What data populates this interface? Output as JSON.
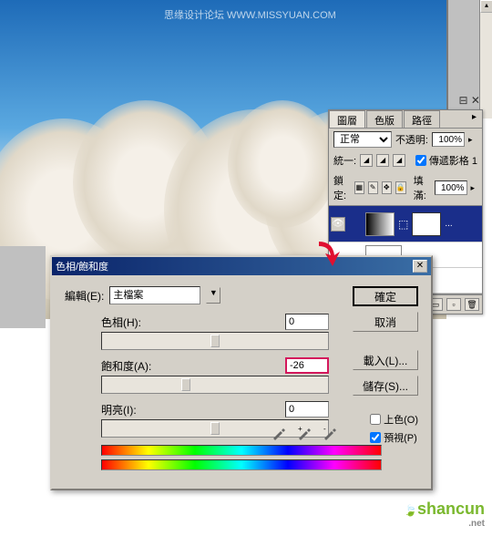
{
  "watermark_top": "思缘设计论坛 WWW.MISSYUAN.COM",
  "layers_panel": {
    "tabs": [
      "圖層",
      "色版",
      "路徑"
    ],
    "blend_mode": "正常",
    "opacity_label": "不透明:",
    "opacity_value": "100%",
    "unify_label": "統一:",
    "propagate_label": "傳遞影格 1",
    "lock_label": "鎖定:",
    "fill_label": "填滿:",
    "fill_value": "100%",
    "layer_name": "..."
  },
  "dialog": {
    "title": "色相/飽和度",
    "edit_label": "編輯(E):",
    "edit_value": "主檔案",
    "hue_label": "色相(H):",
    "hue_value": "0",
    "saturation_label": "飽和度(A):",
    "saturation_value": "-26",
    "lightness_label": "明亮(I):",
    "lightness_value": "0",
    "buttons": {
      "ok": "確定",
      "cancel": "取消",
      "load": "載入(L)...",
      "save": "儲存(S)..."
    },
    "colorize_label": "上色(O)",
    "preview_label": "預視(P)"
  },
  "watermark_br": {
    "main": "shancun",
    "suffix": ".net"
  }
}
